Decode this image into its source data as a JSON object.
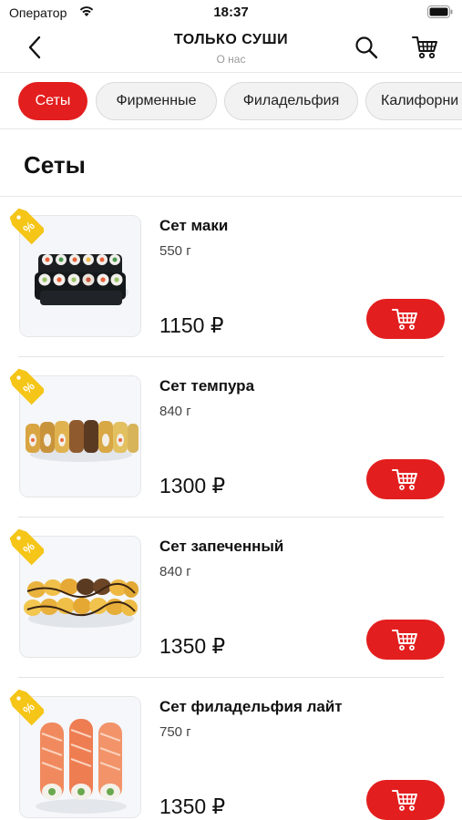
{
  "status_bar": {
    "carrier": "Оператор",
    "time": "18:37"
  },
  "header": {
    "title": "ТОЛЬКО СУШИ",
    "subtitle": "О нас"
  },
  "categories": [
    {
      "label": "Сеты",
      "active": true
    },
    {
      "label": "Фирменные",
      "active": false
    },
    {
      "label": "Филадельфия",
      "active": false
    },
    {
      "label": "Калифорни",
      "active": false
    }
  ],
  "section": {
    "title": "Сеты"
  },
  "products": [
    {
      "name": "Сет маки",
      "weight": "550 г",
      "price": "1150 ₽",
      "icon": "sushi-maki-set"
    },
    {
      "name": "Сет темпура",
      "weight": "840 г",
      "price": "1300 ₽",
      "icon": "sushi-tempura-set"
    },
    {
      "name": "Сет запеченный",
      "weight": "840 г",
      "price": "1350 ₽",
      "icon": "sushi-baked-set"
    },
    {
      "name": "Сет филадельфия лайт",
      "weight": "750 г",
      "price": "1350 ₽",
      "icon": "sushi-philadelphia-set"
    }
  ],
  "colors": {
    "accent": "#e31e1e",
    "badge": "#f5c518",
    "chip_bg": "#f2f2f2"
  }
}
